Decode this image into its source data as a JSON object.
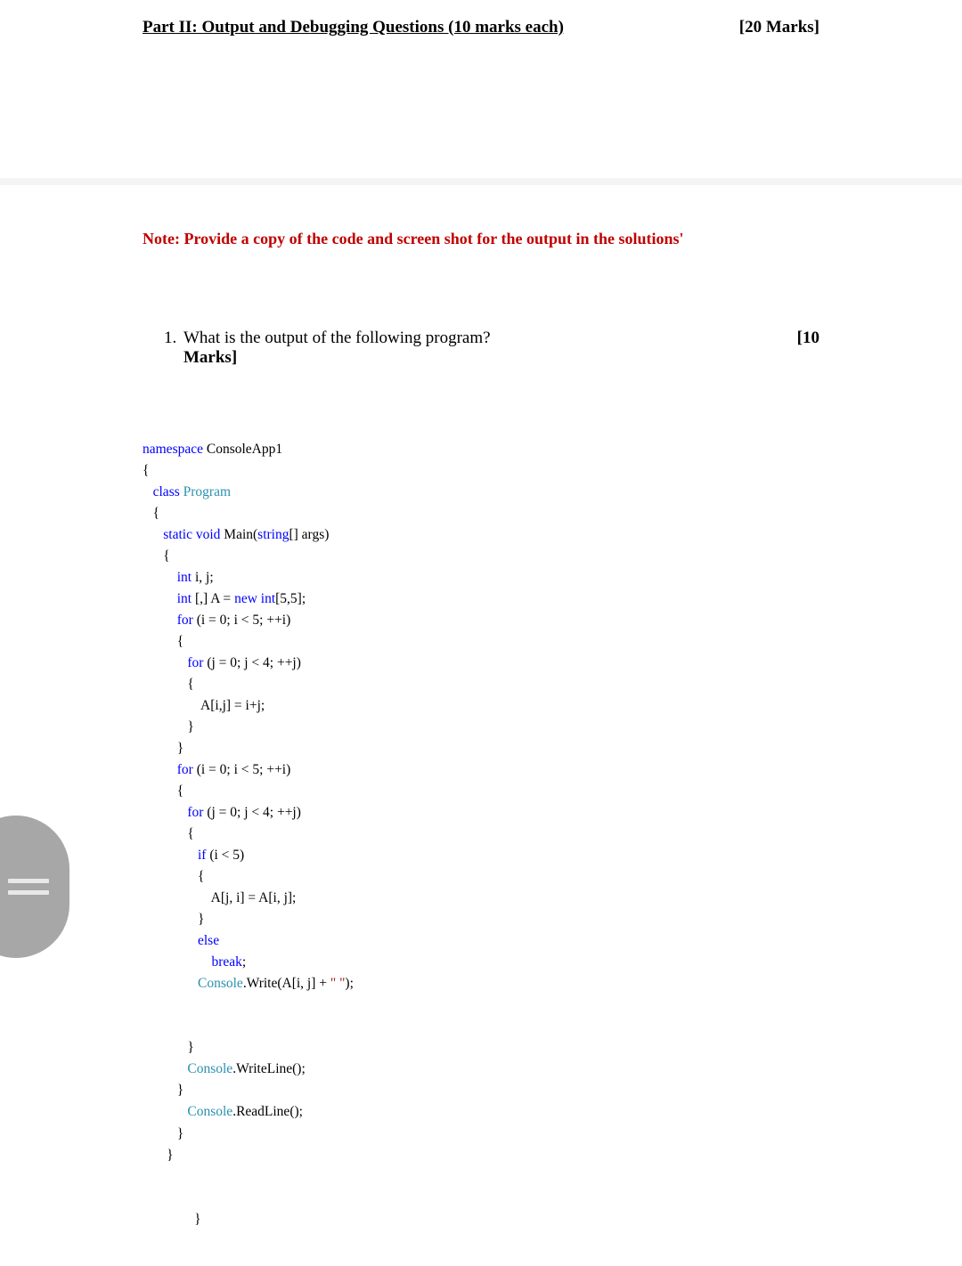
{
  "header": {
    "title": "Part II: Output and Debugging Questions (10 marks each)",
    "marks": "[20 Marks]"
  },
  "note": "Note: Provide a copy of the code and screen shot for the output in the solutions'",
  "question": {
    "number": "1.",
    "text": "What is the output of the following program?",
    "marks_right": "[10",
    "marks_trail": "Marks]"
  },
  "code": {
    "t_namespace": "namespace",
    "t_consoleapp": " ConsoleApp1",
    "t_openbrace": "{",
    "t_class": "class",
    "t_program": " Program",
    "t_static": "static",
    "t_void": " void",
    "t_main_open": " Main(",
    "t_string": "string",
    "t_main_close": "[] args)",
    "t_int": "int",
    "t_ij": " i, j;",
    "t_arrdecl1": " [,] A = ",
    "t_new": "new",
    "t_arrdecl2": " int",
    "t_arrdecl3": "[5,5];",
    "t_for": "for",
    "t_for1": " (i = 0; i < 5; ++i)",
    "t_for2": " (j = 0; j < 4; ++j)",
    "t_assign1": "A[i,j] = i+j;",
    "t_closebrace": "}",
    "t_if": "if",
    "t_ifcond": " (i < 5)",
    "t_assign2": "A[j, i] = A[i, j];",
    "t_else": "else",
    "t_break": "break",
    "t_semi": ";",
    "t_console": "Console",
    "t_write": ".Write(A[i, j] + ",
    "t_space_str": "\" \"",
    "t_write_end": ");",
    "t_writeline": ".WriteLine();",
    "t_readline": ".ReadLine();"
  }
}
